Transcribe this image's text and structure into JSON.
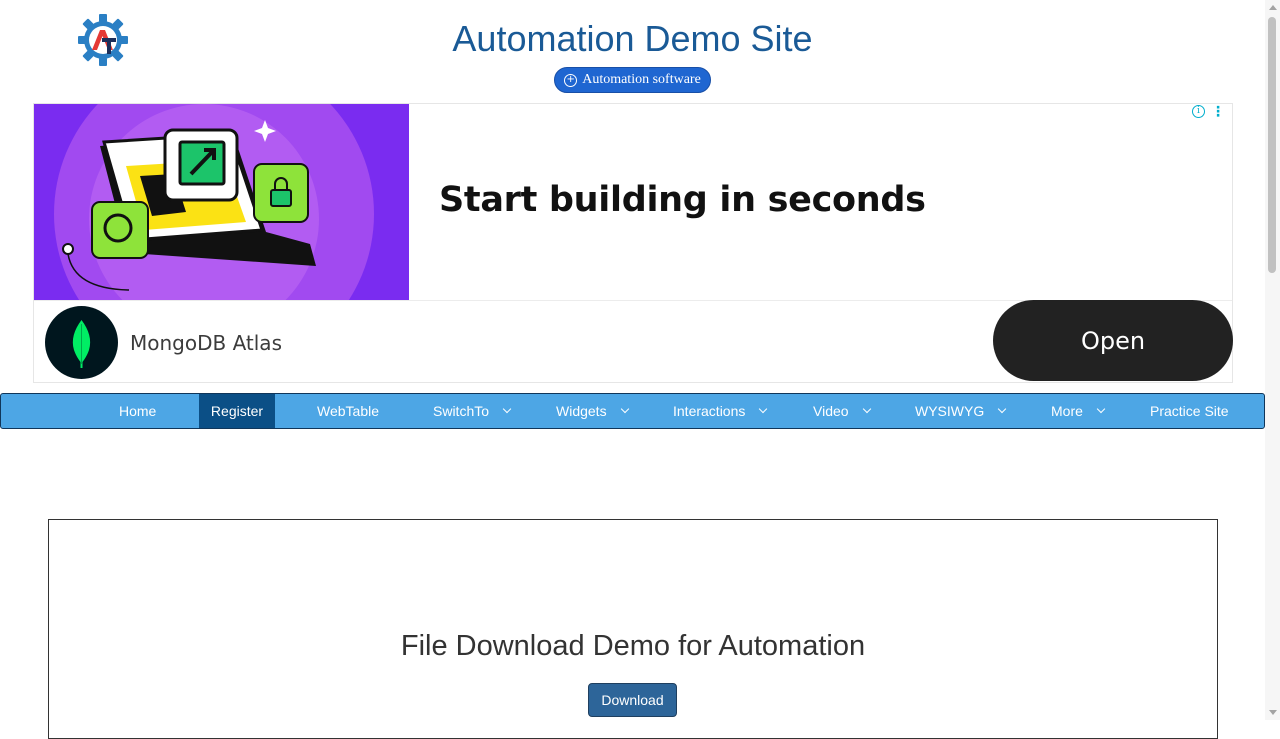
{
  "site": {
    "title": "Automation Demo Site",
    "pill_label": "Automation software",
    "logo_icon": "gear-icon"
  },
  "ad": {
    "headline": "Start building in seconds",
    "brand_name": "MongoDB Atlas",
    "cta_label": "Open",
    "info_icon": "info-icon",
    "menu_icon": "more-vertical-icon",
    "colors": {
      "image_bg": "#7a2cf0",
      "cta_bg": "#222222",
      "brand_logo_bg": "#00161e",
      "leaf": "#00ed64"
    }
  },
  "nav": {
    "items": [
      {
        "label": "Home"
      },
      {
        "label": "Register",
        "active": true
      },
      {
        "label": "WebTable"
      },
      {
        "label": "SwitchTo",
        "dropdown": true
      },
      {
        "label": "Widgets",
        "dropdown": true
      },
      {
        "label": "Interactions",
        "dropdown": true
      },
      {
        "label": "Video",
        "dropdown": true
      },
      {
        "label": "WYSIWYG",
        "dropdown": true
      },
      {
        "label": "More",
        "dropdown": true
      },
      {
        "label": "Practice Site"
      }
    ],
    "colors": {
      "bg": "#4da6e5",
      "active_bg": "#0b4f86"
    }
  },
  "main": {
    "heading": "File Download Demo for Automation",
    "download_label": "Download"
  }
}
